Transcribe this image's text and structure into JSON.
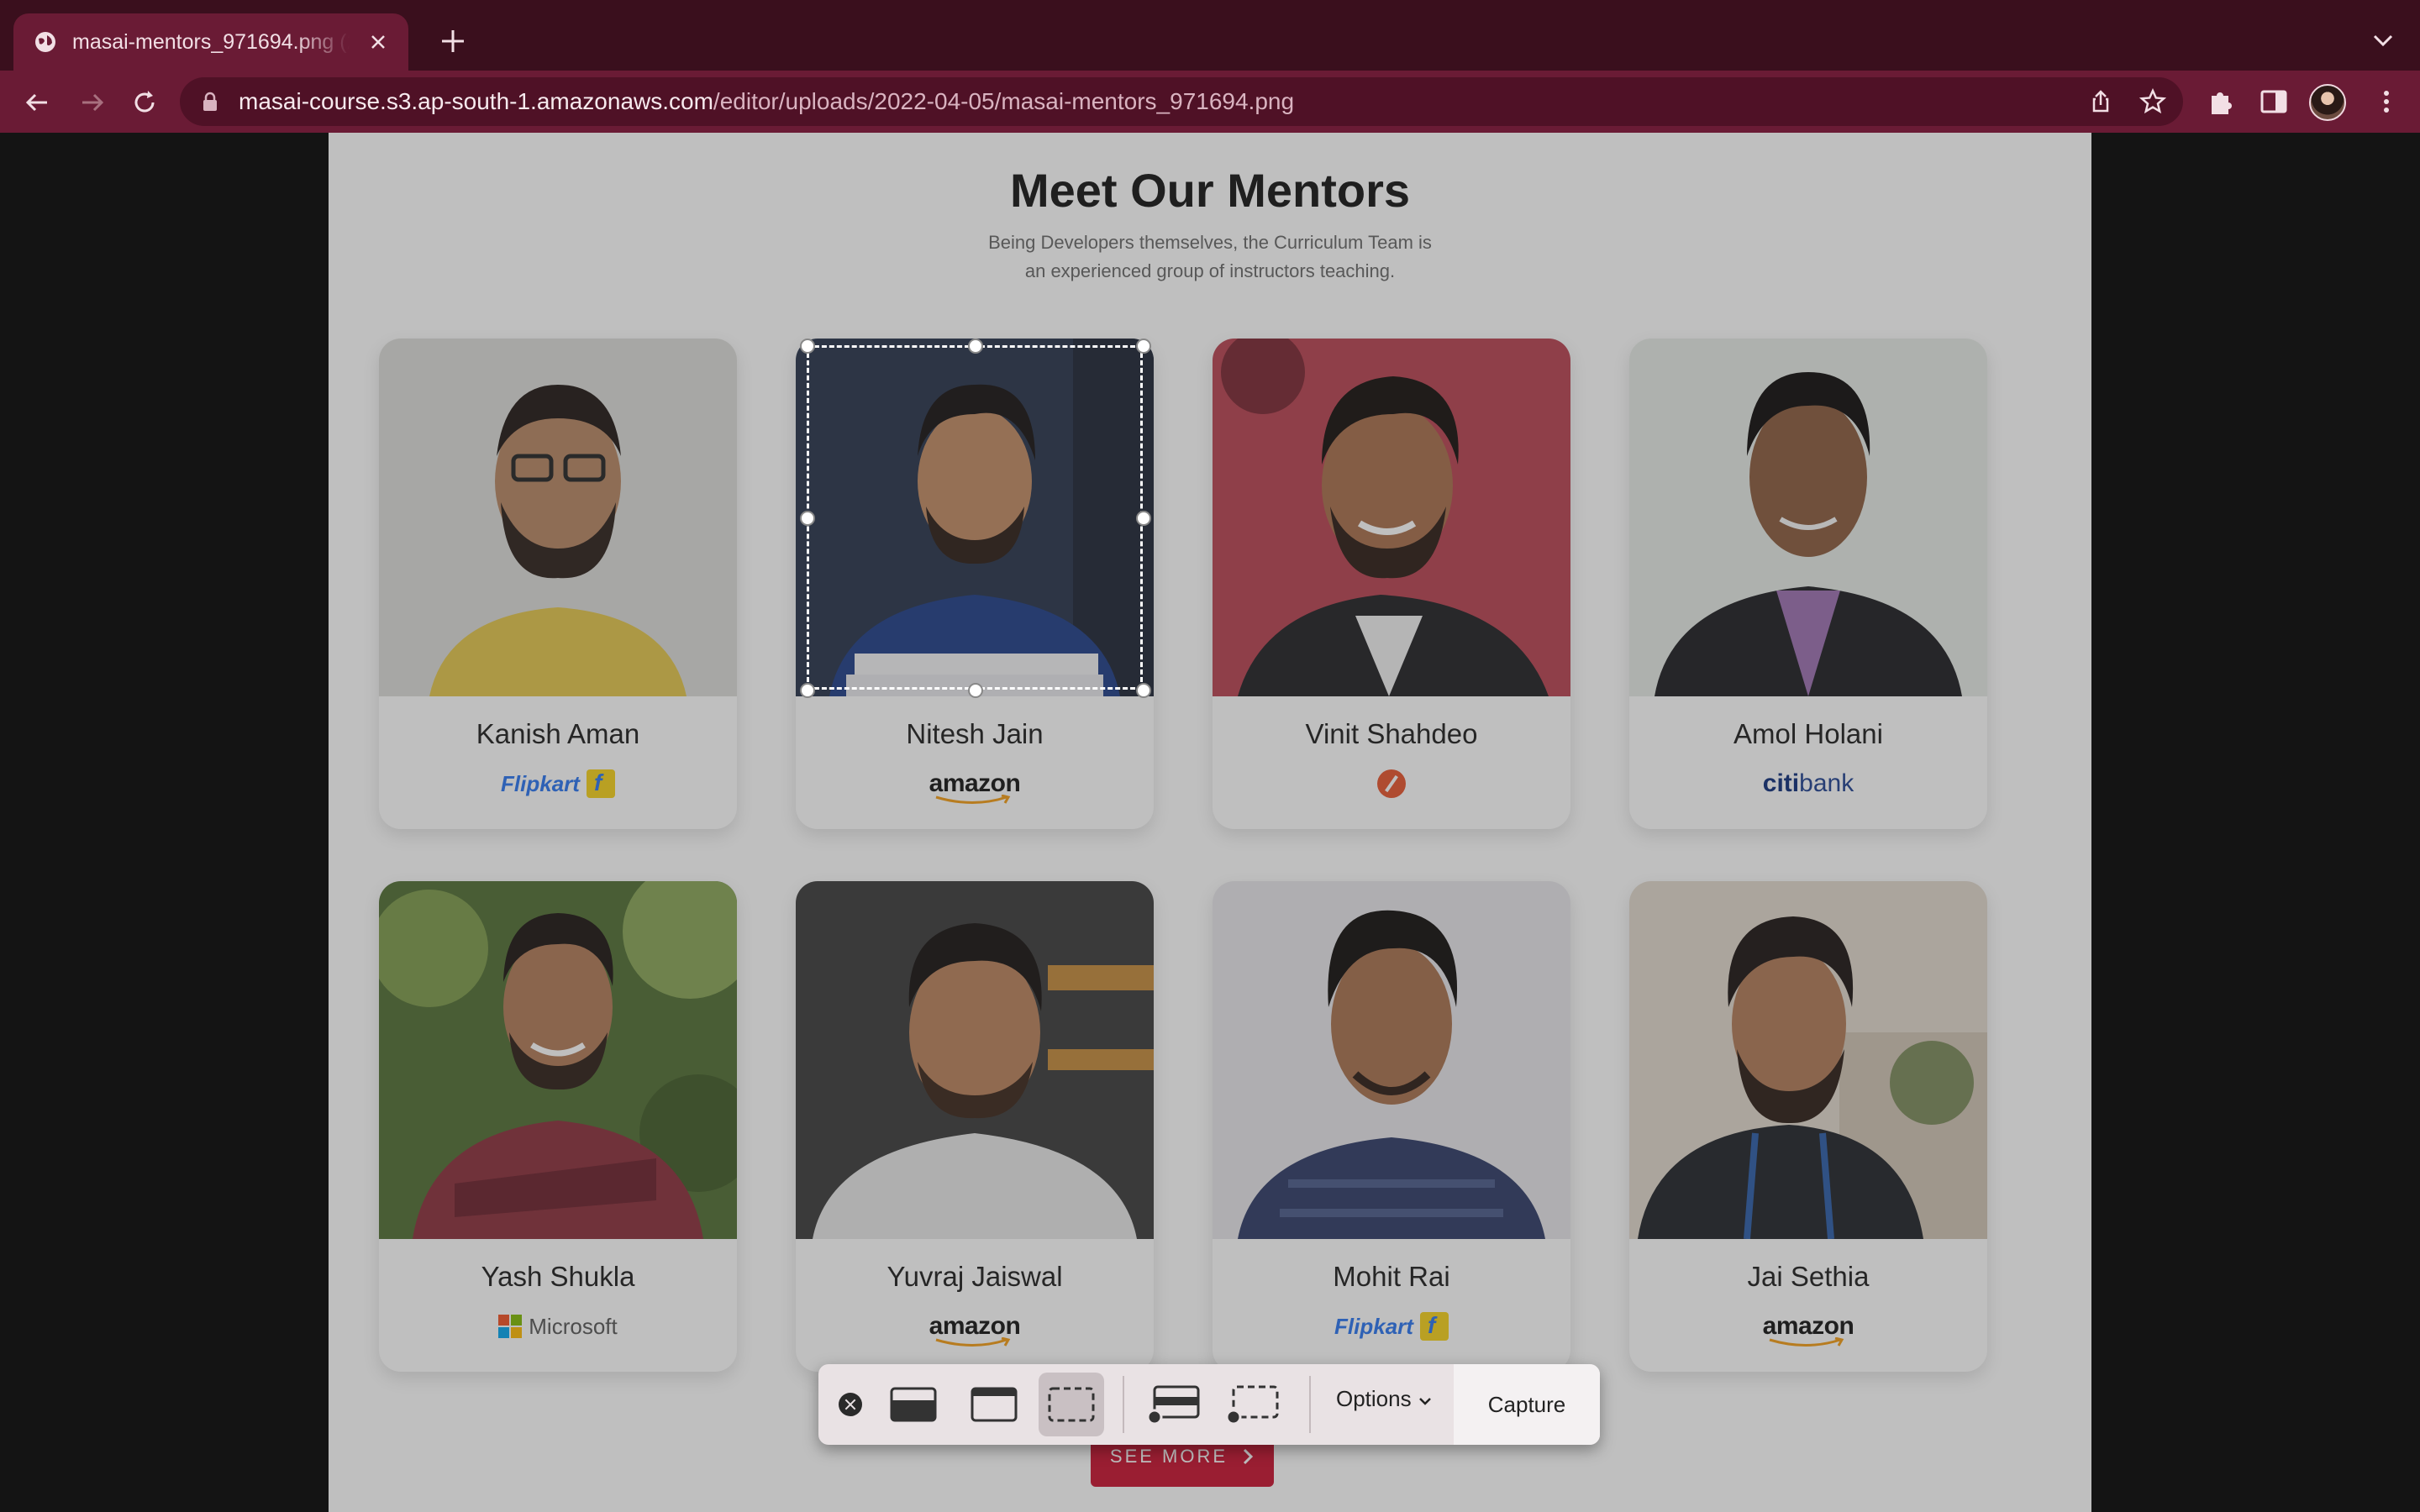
{
  "browser": {
    "tab": {
      "title": "masai-mentors_971694.png (2"
    },
    "url": {
      "host": "masai-course.s3.ap-south-1.amazonaws.com",
      "path": "/editor/uploads/2022-04-05/masai-mentors_971694.png"
    }
  },
  "page": {
    "heading": "Meet Our Mentors",
    "subheading_line1": "Being Developers themselves, the Curriculum Team is",
    "subheading_line2": "an experienced group of instructors teaching.",
    "see_more": "SEE MORE",
    "mentors": [
      {
        "name": "Kanish Aman",
        "company": "Flipkart"
      },
      {
        "name": "Nitesh Jain",
        "company": "amazon"
      },
      {
        "name": "Vinit Shahdeo",
        "company": ""
      },
      {
        "name": "Amol Holani",
        "company": "citibank"
      },
      {
        "name": "Yash Shukla",
        "company": "Microsoft"
      },
      {
        "name": "Yuvraj Jaiswal",
        "company": "amazon"
      },
      {
        "name": "Mohit Rai",
        "company": "Flipkart"
      },
      {
        "name": "Jai Sethia",
        "company": "amazon"
      }
    ]
  },
  "screenshot_tool": {
    "options_label": "Options",
    "capture_label": "Capture"
  },
  "colors": {
    "tab_bar": "#3a0f1d",
    "toolbar": "#6a1b35",
    "accent_red": "#c8102e"
  }
}
